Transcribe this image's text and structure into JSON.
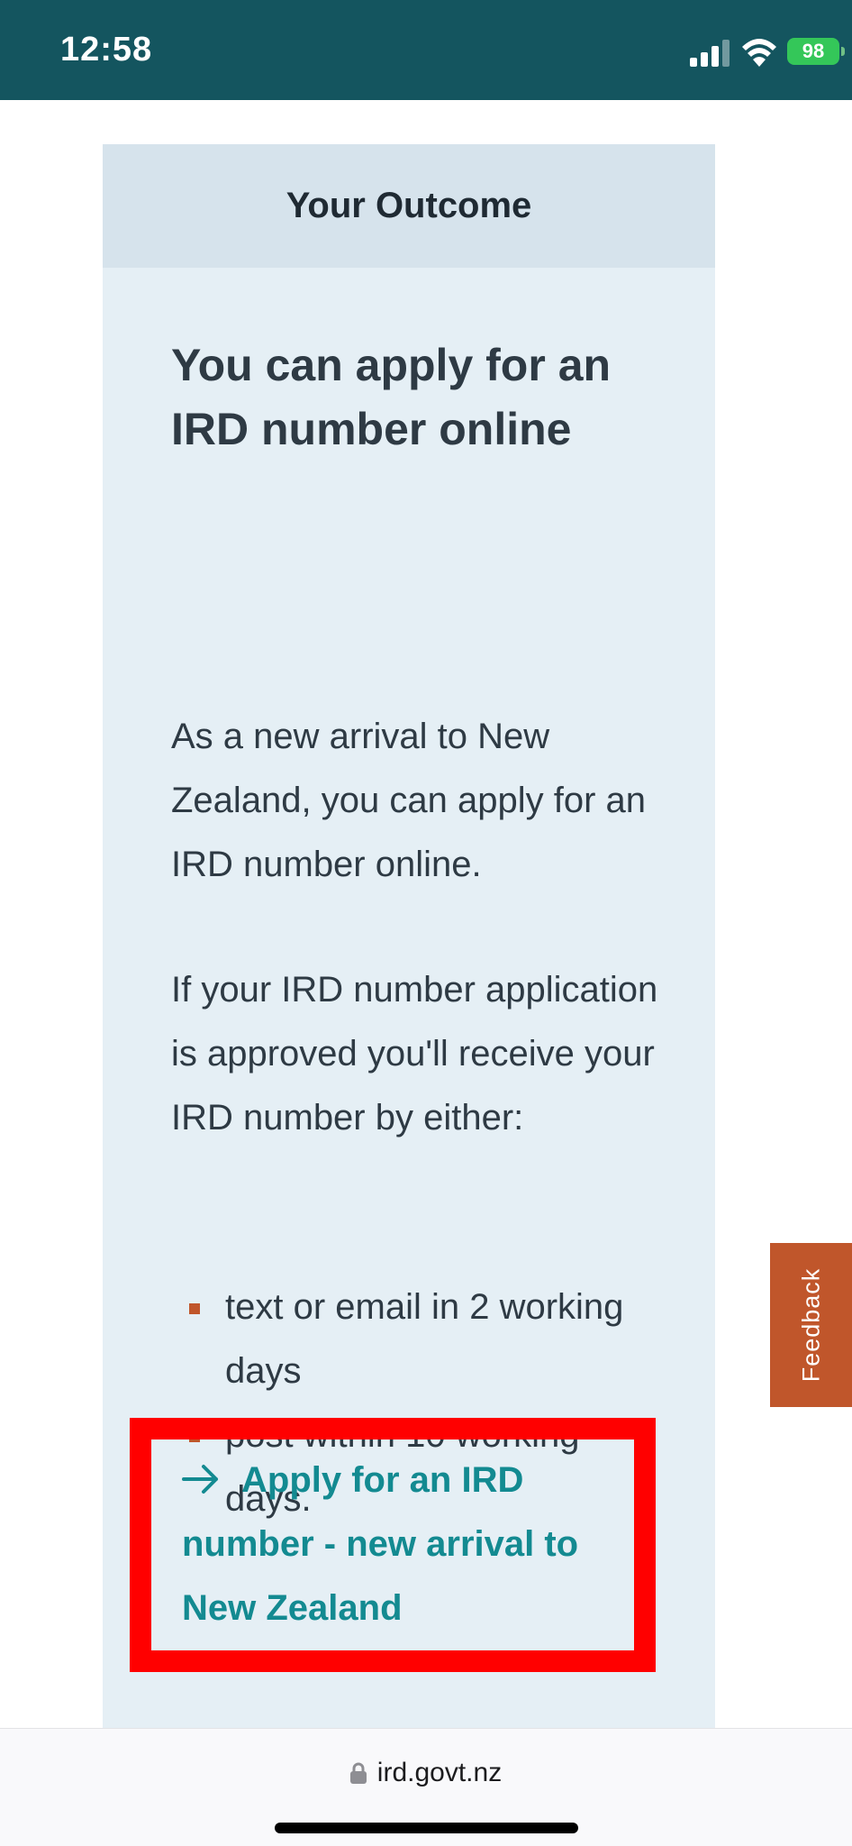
{
  "status_bar": {
    "time": "12:58",
    "battery": "98",
    "icons": [
      "signal-icon",
      "wifi-icon",
      "battery-icon"
    ]
  },
  "outcome": {
    "header": "Your Outcome",
    "heading": "You can apply for an IRD number online",
    "paragraph_1": "As a new arrival to New Zealand, you can apply for an IRD number online.",
    "paragraph_2": "If your IRD number application is approved you'll receive your IRD number by either:",
    "list": [
      "text or email in 2 working days",
      "post within 10 working days."
    ]
  },
  "apply_link": {
    "label": "Apply for an IRD number - new arrival to New Zealand",
    "icon": "arrow-right-icon"
  },
  "feedback": {
    "label": "Feedback"
  },
  "url_bar": {
    "domain": "ird.govt.nz",
    "icon": "lock-icon"
  },
  "colors": {
    "status_bar": "#14555f",
    "card_bg": "#e5eff5",
    "card_header_bg": "#d6e3ec",
    "link": "#138a91",
    "accent": "#c0562b",
    "highlight": "#ff0000"
  }
}
